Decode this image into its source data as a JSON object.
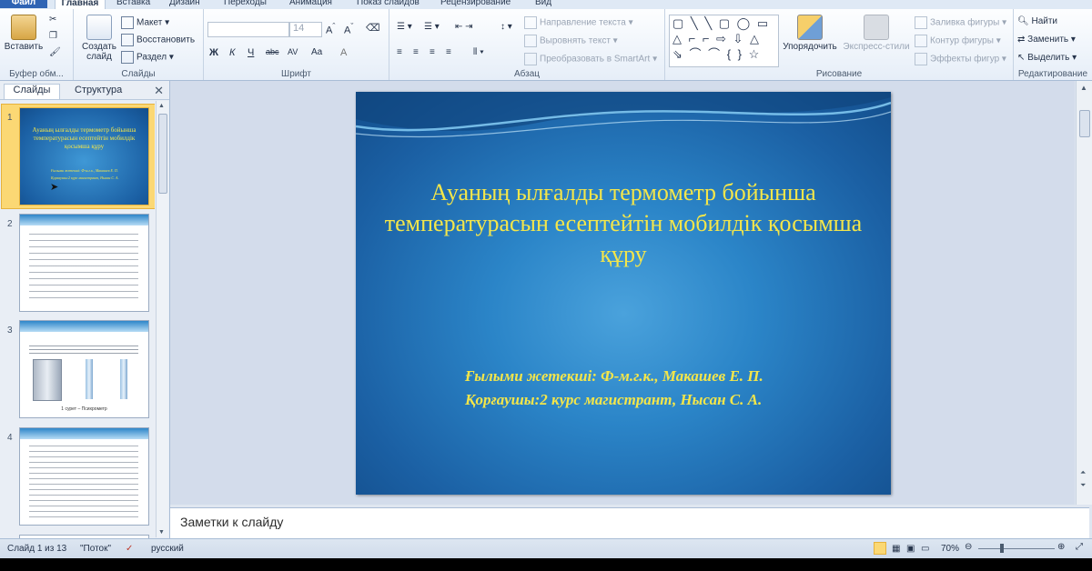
{
  "tabs": [
    "Файл",
    "Главная",
    "Вставка",
    "Дизайн",
    "Переходы",
    "Анимация",
    "Показ слайдов",
    "Рецензирование",
    "Вид"
  ],
  "ribbon": {
    "clipboard": {
      "paste": "Вставить",
      "label": "Буфер обм..."
    },
    "slides": {
      "new_slide": "Создать слайд",
      "layout": "Макет",
      "reset": "Восстановить",
      "section": "Раздел",
      "label": "Слайды"
    },
    "font": {
      "font_name": "",
      "font_size": "14",
      "bold": "Ж",
      "italic": "К",
      "underline": "Ч",
      "strike": "abc",
      "spacing": "AV",
      "case": "Aa",
      "label": "Шрифт"
    },
    "paragraph": {
      "text_direction": "Направление текста",
      "align_text": "Выровнять текст",
      "smartart": "Преобразовать в SmartArt",
      "label": "Абзац"
    },
    "drawing": {
      "arrange": "Упорядочить",
      "quick_styles": "Экспресс-стили",
      "fill": "Заливка фигуры",
      "outline": "Контур фигуры",
      "effects": "Эффекты фигур",
      "label": "Рисование"
    },
    "editing": {
      "find": "Найти",
      "replace": "Заменить",
      "select": "Выделить",
      "label": "Редактирование"
    }
  },
  "left_pane": {
    "tab_slides": "Слайды",
    "tab_outline": "Структура",
    "close": "✕",
    "thumbs": [
      {
        "num": "1",
        "title": "Ауаның ылғалды термометр бойынша температурасын есептейтін мобилдік қосымша құру",
        "sub1": "Ғылыми жетекші: Ф-м.г.к., Макашев Е. П.",
        "sub2": "Қорғаушы:2 курс магистрант, Нысан С. А."
      },
      {
        "num": "2"
      },
      {
        "num": "3",
        "caption": "1 сурет – Психрометр"
      },
      {
        "num": "4"
      }
    ]
  },
  "slide": {
    "title": "Ауаның ылғалды термометр бойынша температурасын есептейтін мобилдік қосымша құру",
    "supervisor": "Ғылыми жетекші: Ф-м.г.к., Макашев Е. П.",
    "student": "Қорғаушы:2 курс магистрант, Нысан С. А."
  },
  "notes": {
    "placeholder": "Заметки к слайду"
  },
  "status": {
    "slide_counter": "Слайд 1 из 13",
    "theme": "\"Поток\"",
    "language": "русский",
    "zoom": "70%"
  },
  "colors": {
    "accent": "#2f64b4",
    "slide_text": "#f4e64a",
    "slide_bg": "#1b60a4",
    "selection": "#fbd874"
  }
}
